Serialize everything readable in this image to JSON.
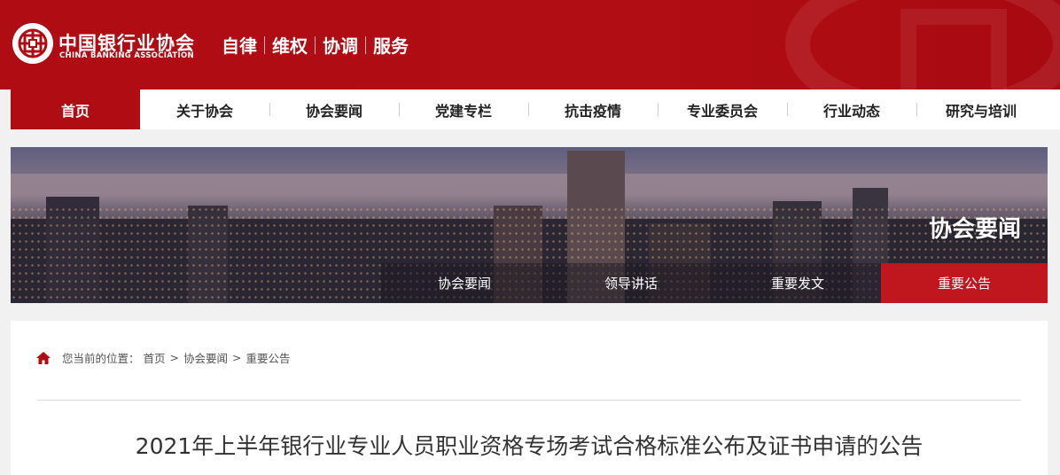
{
  "header": {
    "logo_cn": "中国银行业协会",
    "logo_en": "CHINA BANKING ASSOCIATION",
    "slogan": [
      "自律",
      "维权",
      "协调",
      "服务"
    ]
  },
  "nav": {
    "items": [
      {
        "label": "首页",
        "active": true
      },
      {
        "label": "关于协会",
        "active": false
      },
      {
        "label": "协会要闻",
        "active": false
      },
      {
        "label": "党建专栏",
        "active": false
      },
      {
        "label": "抗击疫情",
        "active": false
      },
      {
        "label": "专业委员会",
        "active": false
      },
      {
        "label": "行业动态",
        "active": false
      },
      {
        "label": "研究与培训",
        "active": false
      }
    ]
  },
  "banner": {
    "title": "协会要闻",
    "subtabs": [
      {
        "label": "协会要闻",
        "active": false
      },
      {
        "label": "领导讲话",
        "active": false
      },
      {
        "label": "重要发文",
        "active": false
      },
      {
        "label": "重要公告",
        "active": true
      }
    ]
  },
  "breadcrumb": {
    "prefix": "您当前的位置：",
    "items": [
      "首页",
      "协会要闻",
      "重要公告"
    ],
    "separator": ">"
  },
  "article": {
    "title": "2021年上半年银行业专业人员职业资格专场考试合格标准公布及证书申请的公告"
  },
  "colors": {
    "brand_red": "#b00c13",
    "active_tab_red": "#c0161d"
  }
}
